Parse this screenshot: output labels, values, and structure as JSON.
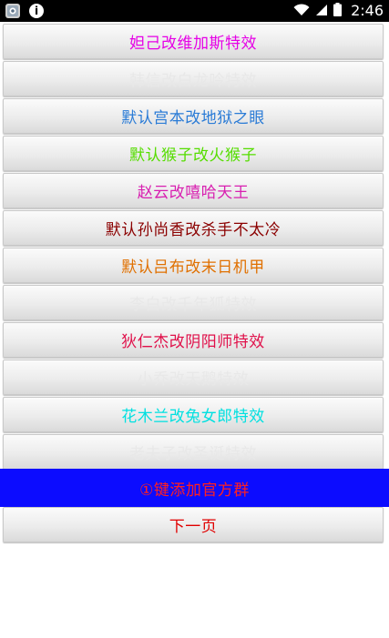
{
  "status_bar": {
    "time": "2:46",
    "info_glyph": "i",
    "icons": [
      "app-icon",
      "info-icon",
      "wifi-icon",
      "signal-icon",
      "battery-icon"
    ]
  },
  "buttons": [
    {
      "label": "妲己改维加斯特效",
      "color": "#e600e6"
    },
    {
      "label": "韩信改白龙吟特效",
      "color": "#e8e8e8"
    },
    {
      "label": "默认宫本改地狱之眼",
      "color": "#2a7bd6"
    },
    {
      "label": "默认猴子改火猴子",
      "color": "#55dd00"
    },
    {
      "label": "赵云改嘻哈天王",
      "color": "#d81fb0"
    },
    {
      "label": "默认孙尚香改杀手不太冷",
      "color": "#8b0000"
    },
    {
      "label": "默认吕布改末日机甲",
      "color": "#e07000"
    },
    {
      "label": "李白改千年狐特效",
      "color": "#e8e8e8"
    },
    {
      "label": "狄仁杰改阴阳师特效",
      "color": "#e0104a"
    },
    {
      "label": "小乔改天鹅特效",
      "color": "#e8e8e8"
    },
    {
      "label": "花木兰改兔女郎特效",
      "color": "#00e0e0"
    },
    {
      "label": "老夫子改圣诞特效",
      "color": "#e8e8e8"
    },
    {
      "label": "①键添加官方群",
      "color": "#ff2020",
      "background": "#0c0cff"
    },
    {
      "label": "下一页",
      "color": "#e00000"
    }
  ]
}
